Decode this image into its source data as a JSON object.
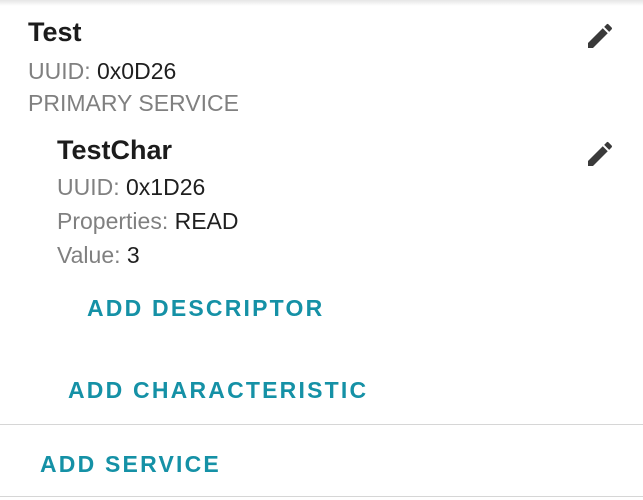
{
  "service": {
    "name": "Test",
    "uuid_label": "UUID:",
    "uuid_value": "0x0D26",
    "type": "PRIMARY SERVICE",
    "edit_icon": "pencil-icon"
  },
  "characteristic": {
    "name": "TestChar",
    "uuid_label": "UUID:",
    "uuid_value": "0x1D26",
    "properties_label": "Properties:",
    "properties_value": "READ",
    "value_label": "Value:",
    "value_value": "3",
    "edit_icon": "pencil-icon"
  },
  "actions": {
    "add_descriptor": "ADD DESCRIPTOR",
    "add_characteristic": "ADD CHARACTERISTIC",
    "add_service": "ADD SERVICE"
  },
  "colors": {
    "accent": "#1591a6",
    "secondary_text": "#808080",
    "primary_text": "#1c1c1c",
    "icon": "#3a3a3a",
    "divider": "#d6d6d6"
  }
}
